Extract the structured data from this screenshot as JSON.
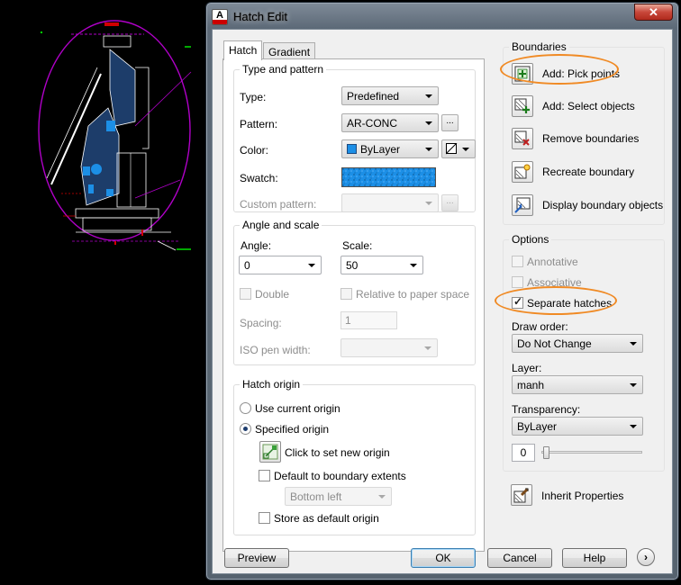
{
  "window": {
    "title": "Hatch Edit",
    "app_icon_letter": "A",
    "close_glyph": "✕"
  },
  "tabs": {
    "hatch": "Hatch",
    "gradient": "Gradient"
  },
  "type_pattern": {
    "group_label": "Type and pattern",
    "type_label": "Type:",
    "type_value": "Predefined",
    "pattern_label": "Pattern:",
    "pattern_value": "AR-CONC",
    "pattern_browse": "...",
    "color_label": "Color:",
    "color_value": "ByLayer",
    "color_swatch": "#1c8fe6",
    "swatch_label": "Swatch:",
    "custom_label": "Custom pattern:",
    "custom_browse": "..."
  },
  "angle_scale": {
    "group_label": "Angle and scale",
    "angle_label": "Angle:",
    "angle_value": "0",
    "scale_label": "Scale:",
    "scale_value": "50",
    "double_label": "Double",
    "relative_label": "Relative to paper space",
    "spacing_label": "Spacing:",
    "spacing_value": "1",
    "iso_label": "ISO pen width:"
  },
  "origin": {
    "group_label": "Hatch origin",
    "use_current": "Use current origin",
    "specified": "Specified origin",
    "click_new": "Click to set new origin",
    "default_extents": "Default to boundary extents",
    "position_value": "Bottom left",
    "store_default": "Store as default origin"
  },
  "boundaries": {
    "group_label": "Boundaries",
    "add_pick": "Add: Pick points",
    "add_select": "Add: Select objects",
    "remove": "Remove boundaries",
    "recreate": "Recreate boundary",
    "display": "Display boundary objects"
  },
  "options": {
    "group_label": "Options",
    "annotative": "Annotative",
    "associative": "Associative",
    "separate": "Separate hatches",
    "separate_checked": true,
    "draw_order_label": "Draw order:",
    "draw_order_value": "Do Not Change",
    "layer_label": "Layer:",
    "layer_value": "manh",
    "transparency_label": "Transparency:",
    "transparency_value": "ByLayer",
    "transparency_amount": "0"
  },
  "inherit": "Inherit Properties",
  "buttons": {
    "preview": "Preview",
    "ok": "OK",
    "cancel": "Cancel",
    "help": "Help",
    "more": "›"
  },
  "colors": {
    "highlight": "#f08a24",
    "cad_purple": "#b000c8",
    "cad_green": "#00e000"
  }
}
